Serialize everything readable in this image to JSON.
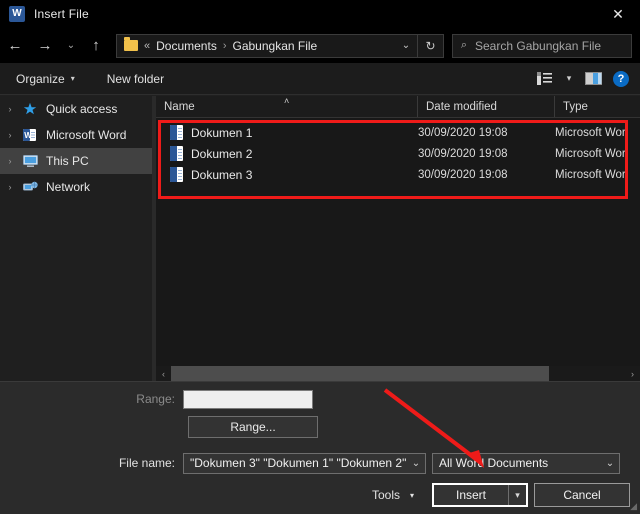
{
  "window": {
    "title": "Insert File",
    "icon": "word-app-icon",
    "icon_letter": "W",
    "close_label": "✕",
    "accent_blue": "#2b5797",
    "annotation_red": "#ee1b19"
  },
  "nav": {
    "back": "←",
    "forward": "→",
    "recent": "⌄",
    "up": "↑",
    "breadcrumb": {
      "leading": "«",
      "items": [
        "Documents",
        "Gabungkan File"
      ],
      "separator": "›"
    },
    "address_caret": "⌄",
    "refresh": "↻",
    "search_placeholder": "Search Gabungkan File",
    "search_icon": "⌕"
  },
  "commandbar": {
    "organize": "Organize",
    "organize_caret": "▾",
    "new_folder": "New folder",
    "view_caret": "▾",
    "help": "?"
  },
  "sidebar": {
    "items": [
      {
        "label": "Quick access",
        "icon": "star-icon",
        "expander": "›",
        "selected": false
      },
      {
        "label": "Microsoft Word",
        "icon": "word-icon",
        "expander": "›",
        "selected": false
      },
      {
        "label": "This PC",
        "icon": "monitor-icon",
        "expander": "›",
        "selected": true
      },
      {
        "label": "Network",
        "icon": "network-icon",
        "expander": "›",
        "selected": false
      }
    ]
  },
  "filelist": {
    "columns": [
      "Name",
      "Date modified",
      "Type"
    ],
    "sort_indicator": "˄",
    "rows": [
      {
        "name": "Dokumen 1",
        "date": "30/09/2020 19:08",
        "type": "Microsoft Wor"
      },
      {
        "name": "Dokumen 2",
        "date": "30/09/2020 19:08",
        "type": "Microsoft Wor"
      },
      {
        "name": "Dokumen 3",
        "date": "30/09/2020 19:08",
        "type": "Microsoft Wor"
      }
    ],
    "scroll_left_arrow": "‹",
    "scroll_right_arrow": "›"
  },
  "lower": {
    "range_label": "Range:",
    "range_value": "",
    "range_placeholder": "",
    "range_button": "Range...",
    "filename_label": "File name:",
    "filename_value": "\"Dokumen 3\" \"Dokumen 1\" \"Dokumen 2\"",
    "filetype_value": "All Word Documents",
    "combo_caret": "⌄",
    "tools_label": "Tools",
    "tools_caret": "▾",
    "insert_label": "Insert",
    "insert_split_caret": "▾",
    "cancel_label": "Cancel"
  }
}
